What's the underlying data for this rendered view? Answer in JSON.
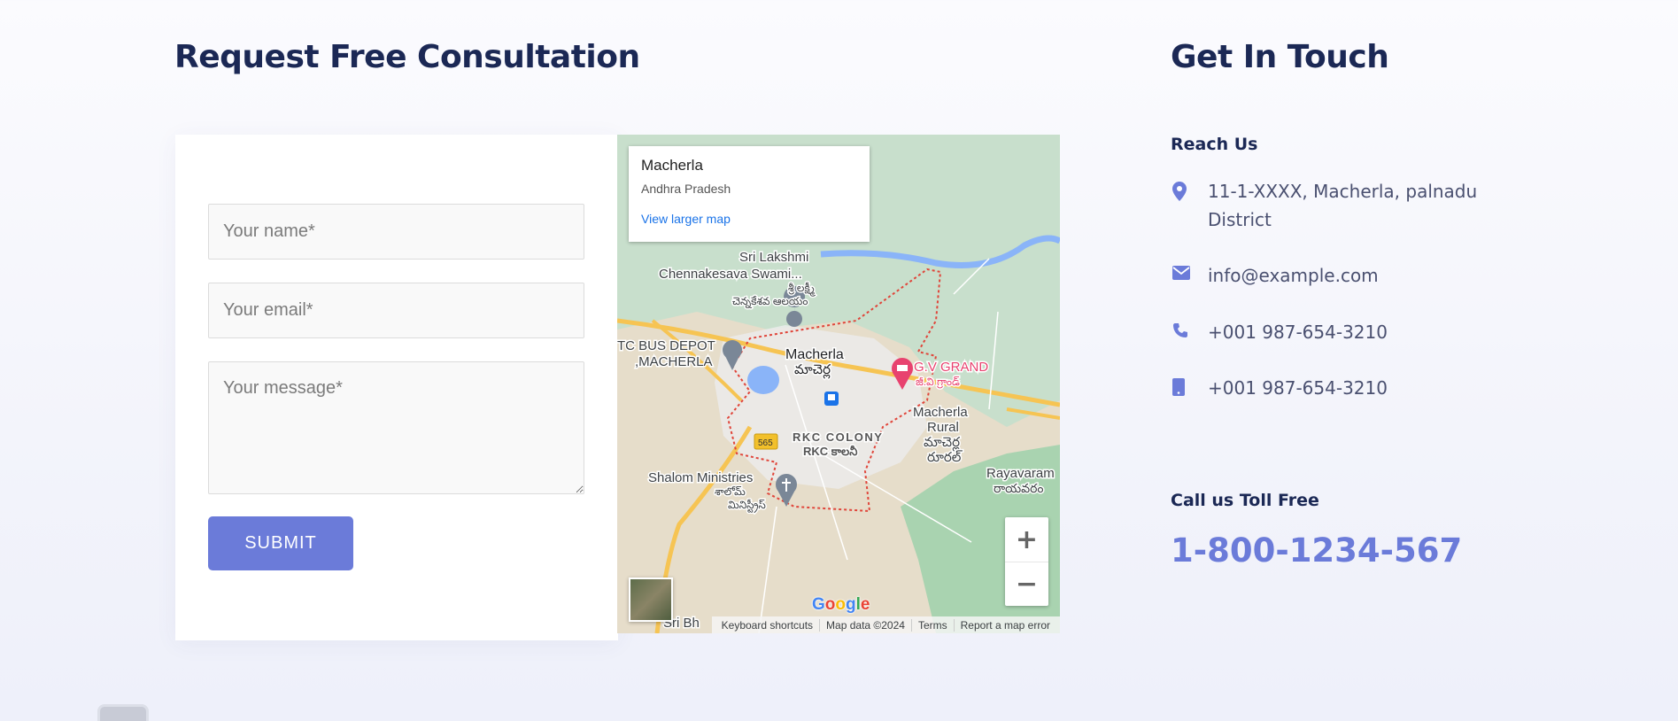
{
  "consultation": {
    "title": "Request Free Consultation",
    "form": {
      "name_placeholder": "Your name*",
      "email_placeholder": "Your email*",
      "message_placeholder": "Your message*",
      "submit_label": "SUBMIT"
    }
  },
  "map": {
    "info": {
      "place": "Macherla",
      "region": "Andhra Pradesh",
      "larger_map_link": "View larger map"
    },
    "labels": {
      "sri_lakshmi": "Sri Lakshmi",
      "chennakesava": "Chennakesava Swami...",
      "chennakesava_te1": "శ్రీ లక్ష్మీ",
      "chennakesava_te2": "చెన్నకేశవ ఆలయం",
      "bus_depot1": "TC BUS DEPOT",
      "bus_depot2": ",MACHERLA",
      "macherla": "Macherla",
      "macherla_te": "మాచెర్ల",
      "gv_grand": "G.V GRAND",
      "gv_grand_te": "జీ.వి గ్రాండ్",
      "macherla_rural1": "Macherla",
      "macherla_rural2": "Rural",
      "macherla_rural_te1": "మాచెర్ల",
      "macherla_rural_te2": "రూరల్",
      "rkc_colony": "RKC COLONY",
      "rkc_colony_te": "RKC కాలనీ",
      "road_565": "565",
      "shalom": "Shalom Ministries",
      "shalom_te1": "శాలోమ్",
      "shalom_te2": "మినిస్ట్రీస్",
      "rayavaram": "Rayavaram",
      "rayavaram_te": "రాయవరం",
      "sri_bh": "Sri Bh"
    },
    "zoom_in": "+",
    "zoom_out": "−",
    "google": [
      "G",
      "o",
      "o",
      "g",
      "l",
      "e"
    ],
    "footer": {
      "shortcuts": "Keyboard shortcuts",
      "map_data": "Map data ©2024",
      "terms": "Terms",
      "report": "Report a map error"
    },
    "colors": {
      "land": "#e6ddca",
      "green": "#c8dfcc",
      "water": "#8ab4f8",
      "road": "#f6c453",
      "boundary": "#e0453a",
      "hotel_pin": "#e8426f"
    }
  },
  "contact": {
    "title": "Get In Touch",
    "reach_label": "Reach Us",
    "address": "11-1-XXXX, Macherla, palnadu District",
    "email": "info@example.com",
    "phone": "+001 987-654-3210",
    "mobile": "+001 987-654-3210",
    "toll_label": "Call us Toll Free",
    "toll_number": "1-800-1234-567",
    "icons": [
      "location-pin-icon",
      "envelope-icon",
      "phone-icon",
      "mobile-icon"
    ],
    "accent_color": "#6b7bd9"
  }
}
